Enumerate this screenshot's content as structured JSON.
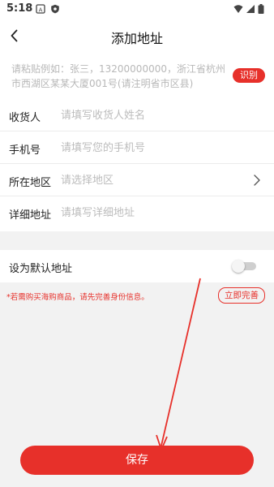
{
  "status_bar": {
    "time": "5:18"
  },
  "header": {
    "title": "添加地址"
  },
  "paste": {
    "hint": "请粘贴例如：张三，13200000000，浙江省杭州市西湖区某某大厦001号(请注明省市区县)",
    "recognize_label": "识别"
  },
  "form": {
    "recipient": {
      "label": "收货人",
      "placeholder": "请填写收货人姓名"
    },
    "phone": {
      "label": "手机号",
      "placeholder": "请填写您的手机号"
    },
    "region": {
      "label": "所在地区",
      "placeholder": "请选择地区"
    },
    "address": {
      "label": "详细地址",
      "placeholder": "请填写详细地址"
    }
  },
  "default_address": {
    "label": "设为默认地址",
    "enabled": false
  },
  "notice": {
    "text": "*若需购买海购商品，请先完善身份信息。",
    "complete_label": "立即完善"
  },
  "save_label": "保存",
  "colors": {
    "accent": "#e7302a"
  }
}
